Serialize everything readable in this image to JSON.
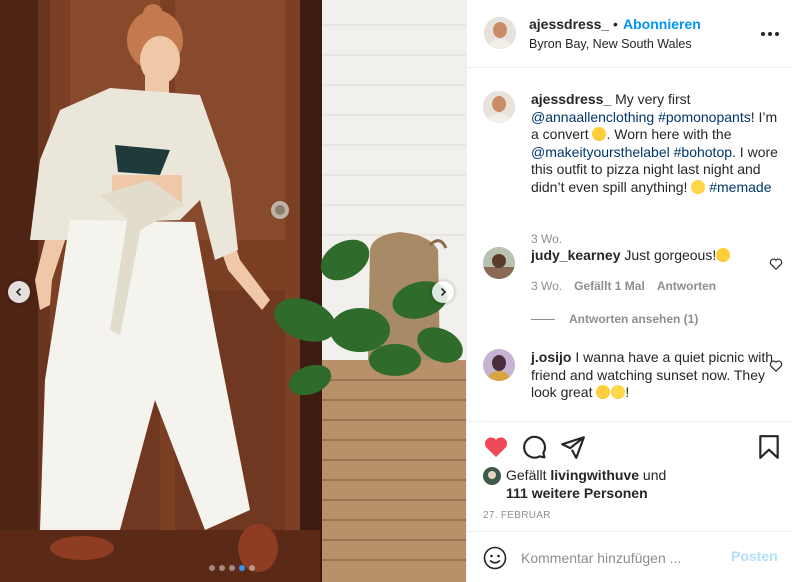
{
  "header": {
    "username": "ajessdress_",
    "separator": "•",
    "follow_label": "Abonnieren",
    "location": "Byron Bay, New South Wales",
    "more_icon": "more-horizontal-icon"
  },
  "photo": {
    "arrows": [
      "chevron-left-icon",
      "chevron-right-icon"
    ],
    "dots_count": 5,
    "active_dot": 3
  },
  "caption": {
    "username": "ajessdress_",
    "t1": " My very first ",
    "mention1": "@annaallenclothing",
    "t2": " ",
    "hashtag1": "#pomonopants",
    "t3": "! I’m a convert ",
    "t4": ". Worn here with the ",
    "mention2": "@makeityoursthelabel",
    "t5": " ",
    "hashtag2": "#bohotop",
    "t6": ". I wore this outfit to pizza night last night and didn’t even spill anything! ",
    "t7": " ",
    "hashtag3": "#memade",
    "time": "3 Wo."
  },
  "comments": [
    {
      "username": "judy_kearney",
      "text": " Just gorgeous!",
      "time": "3 Wo.",
      "likes": "Gefällt 1 Mal",
      "reply_label": "Antworten",
      "view_replies": "Antworten ansehen (1)"
    },
    {
      "username": "j.osijo",
      "text": " I wanna have a quiet picnic with friend and watching sunset now. They look great "
    }
  ],
  "actions": {
    "icons": [
      "heart-icon",
      "comment-icon",
      "share-icon",
      "bookmark-icon"
    ],
    "liked": true
  },
  "likes": {
    "prefix": "Gefällt ",
    "user": "livingwithuve",
    "suffix": " und",
    "others": "111 weitere Personen"
  },
  "date": "27. FEBRUAR",
  "add_comment": {
    "placeholder": "Kommentar hinzufügen ...",
    "post_label": "Posten"
  },
  "colors": {
    "link_blue": "#0095f6",
    "tag_blue": "#00376b",
    "like_red": "#ed4956",
    "muted": "#8e8e8e",
    "post_disabled": "#b2dffc"
  }
}
